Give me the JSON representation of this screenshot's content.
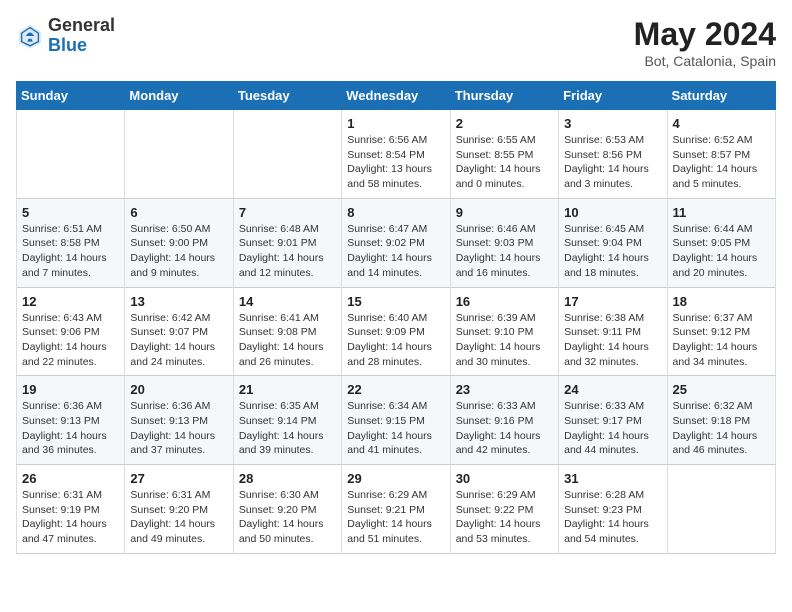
{
  "header": {
    "logo_general": "General",
    "logo_blue": "Blue",
    "title": "May 2024",
    "location": "Bot, Catalonia, Spain"
  },
  "days_of_week": [
    "Sunday",
    "Monday",
    "Tuesday",
    "Wednesday",
    "Thursday",
    "Friday",
    "Saturday"
  ],
  "weeks": [
    [
      {
        "day": "",
        "info": ""
      },
      {
        "day": "",
        "info": ""
      },
      {
        "day": "",
        "info": ""
      },
      {
        "day": "1",
        "info": "Sunrise: 6:56 AM\nSunset: 8:54 PM\nDaylight: 13 hours\nand 58 minutes."
      },
      {
        "day": "2",
        "info": "Sunrise: 6:55 AM\nSunset: 8:55 PM\nDaylight: 14 hours\nand 0 minutes."
      },
      {
        "day": "3",
        "info": "Sunrise: 6:53 AM\nSunset: 8:56 PM\nDaylight: 14 hours\nand 3 minutes."
      },
      {
        "day": "4",
        "info": "Sunrise: 6:52 AM\nSunset: 8:57 PM\nDaylight: 14 hours\nand 5 minutes."
      }
    ],
    [
      {
        "day": "5",
        "info": "Sunrise: 6:51 AM\nSunset: 8:58 PM\nDaylight: 14 hours\nand 7 minutes."
      },
      {
        "day": "6",
        "info": "Sunrise: 6:50 AM\nSunset: 9:00 PM\nDaylight: 14 hours\nand 9 minutes."
      },
      {
        "day": "7",
        "info": "Sunrise: 6:48 AM\nSunset: 9:01 PM\nDaylight: 14 hours\nand 12 minutes."
      },
      {
        "day": "8",
        "info": "Sunrise: 6:47 AM\nSunset: 9:02 PM\nDaylight: 14 hours\nand 14 minutes."
      },
      {
        "day": "9",
        "info": "Sunrise: 6:46 AM\nSunset: 9:03 PM\nDaylight: 14 hours\nand 16 minutes."
      },
      {
        "day": "10",
        "info": "Sunrise: 6:45 AM\nSunset: 9:04 PM\nDaylight: 14 hours\nand 18 minutes."
      },
      {
        "day": "11",
        "info": "Sunrise: 6:44 AM\nSunset: 9:05 PM\nDaylight: 14 hours\nand 20 minutes."
      }
    ],
    [
      {
        "day": "12",
        "info": "Sunrise: 6:43 AM\nSunset: 9:06 PM\nDaylight: 14 hours\nand 22 minutes."
      },
      {
        "day": "13",
        "info": "Sunrise: 6:42 AM\nSunset: 9:07 PM\nDaylight: 14 hours\nand 24 minutes."
      },
      {
        "day": "14",
        "info": "Sunrise: 6:41 AM\nSunset: 9:08 PM\nDaylight: 14 hours\nand 26 minutes."
      },
      {
        "day": "15",
        "info": "Sunrise: 6:40 AM\nSunset: 9:09 PM\nDaylight: 14 hours\nand 28 minutes."
      },
      {
        "day": "16",
        "info": "Sunrise: 6:39 AM\nSunset: 9:10 PM\nDaylight: 14 hours\nand 30 minutes."
      },
      {
        "day": "17",
        "info": "Sunrise: 6:38 AM\nSunset: 9:11 PM\nDaylight: 14 hours\nand 32 minutes."
      },
      {
        "day": "18",
        "info": "Sunrise: 6:37 AM\nSunset: 9:12 PM\nDaylight: 14 hours\nand 34 minutes."
      }
    ],
    [
      {
        "day": "19",
        "info": "Sunrise: 6:36 AM\nSunset: 9:13 PM\nDaylight: 14 hours\nand 36 minutes."
      },
      {
        "day": "20",
        "info": "Sunrise: 6:36 AM\nSunset: 9:13 PM\nDaylight: 14 hours\nand 37 minutes."
      },
      {
        "day": "21",
        "info": "Sunrise: 6:35 AM\nSunset: 9:14 PM\nDaylight: 14 hours\nand 39 minutes."
      },
      {
        "day": "22",
        "info": "Sunrise: 6:34 AM\nSunset: 9:15 PM\nDaylight: 14 hours\nand 41 minutes."
      },
      {
        "day": "23",
        "info": "Sunrise: 6:33 AM\nSunset: 9:16 PM\nDaylight: 14 hours\nand 42 minutes."
      },
      {
        "day": "24",
        "info": "Sunrise: 6:33 AM\nSunset: 9:17 PM\nDaylight: 14 hours\nand 44 minutes."
      },
      {
        "day": "25",
        "info": "Sunrise: 6:32 AM\nSunset: 9:18 PM\nDaylight: 14 hours\nand 46 minutes."
      }
    ],
    [
      {
        "day": "26",
        "info": "Sunrise: 6:31 AM\nSunset: 9:19 PM\nDaylight: 14 hours\nand 47 minutes."
      },
      {
        "day": "27",
        "info": "Sunrise: 6:31 AM\nSunset: 9:20 PM\nDaylight: 14 hours\nand 49 minutes."
      },
      {
        "day": "28",
        "info": "Sunrise: 6:30 AM\nSunset: 9:20 PM\nDaylight: 14 hours\nand 50 minutes."
      },
      {
        "day": "29",
        "info": "Sunrise: 6:29 AM\nSunset: 9:21 PM\nDaylight: 14 hours\nand 51 minutes."
      },
      {
        "day": "30",
        "info": "Sunrise: 6:29 AM\nSunset: 9:22 PM\nDaylight: 14 hours\nand 53 minutes."
      },
      {
        "day": "31",
        "info": "Sunrise: 6:28 AM\nSunset: 9:23 PM\nDaylight: 14 hours\nand 54 minutes."
      },
      {
        "day": "",
        "info": ""
      }
    ]
  ]
}
